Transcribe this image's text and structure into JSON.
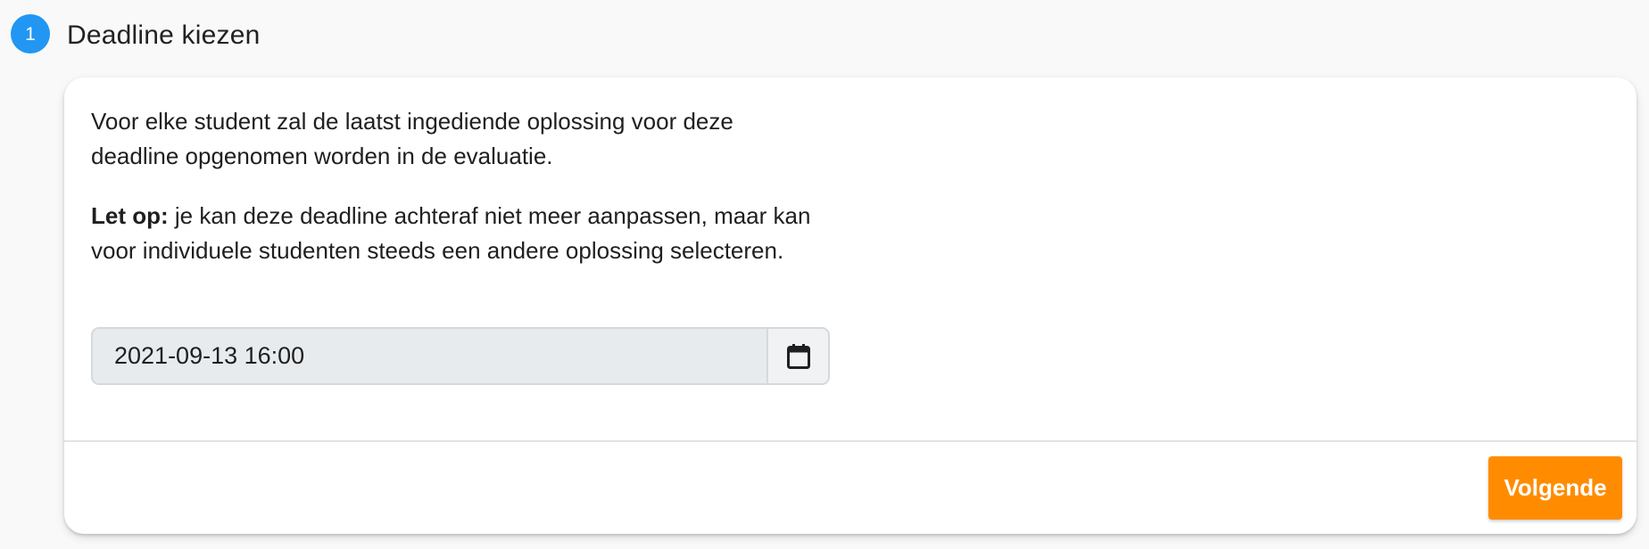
{
  "step": {
    "number": "1",
    "title": "Deadline kiezen"
  },
  "card": {
    "paragraph_1": "Voor elke student zal de laatst ingediende oplossing voor deze deadline opgenomen worden in de evaluatie.",
    "warning_label": "Let op:",
    "warning_text": " je kan deze deadline achteraf niet meer aanpassen, maar kan voor individuele studenten steeds een andere oplossing selecteren.",
    "date_value": "2021-09-13 16:00",
    "date_button_icon": "calendar-icon"
  },
  "footer": {
    "next_label": "Volgende"
  },
  "colors": {
    "step_badge": "#2196f3",
    "next_button": "#ff8c00",
    "input_background": "#e8ebee"
  }
}
